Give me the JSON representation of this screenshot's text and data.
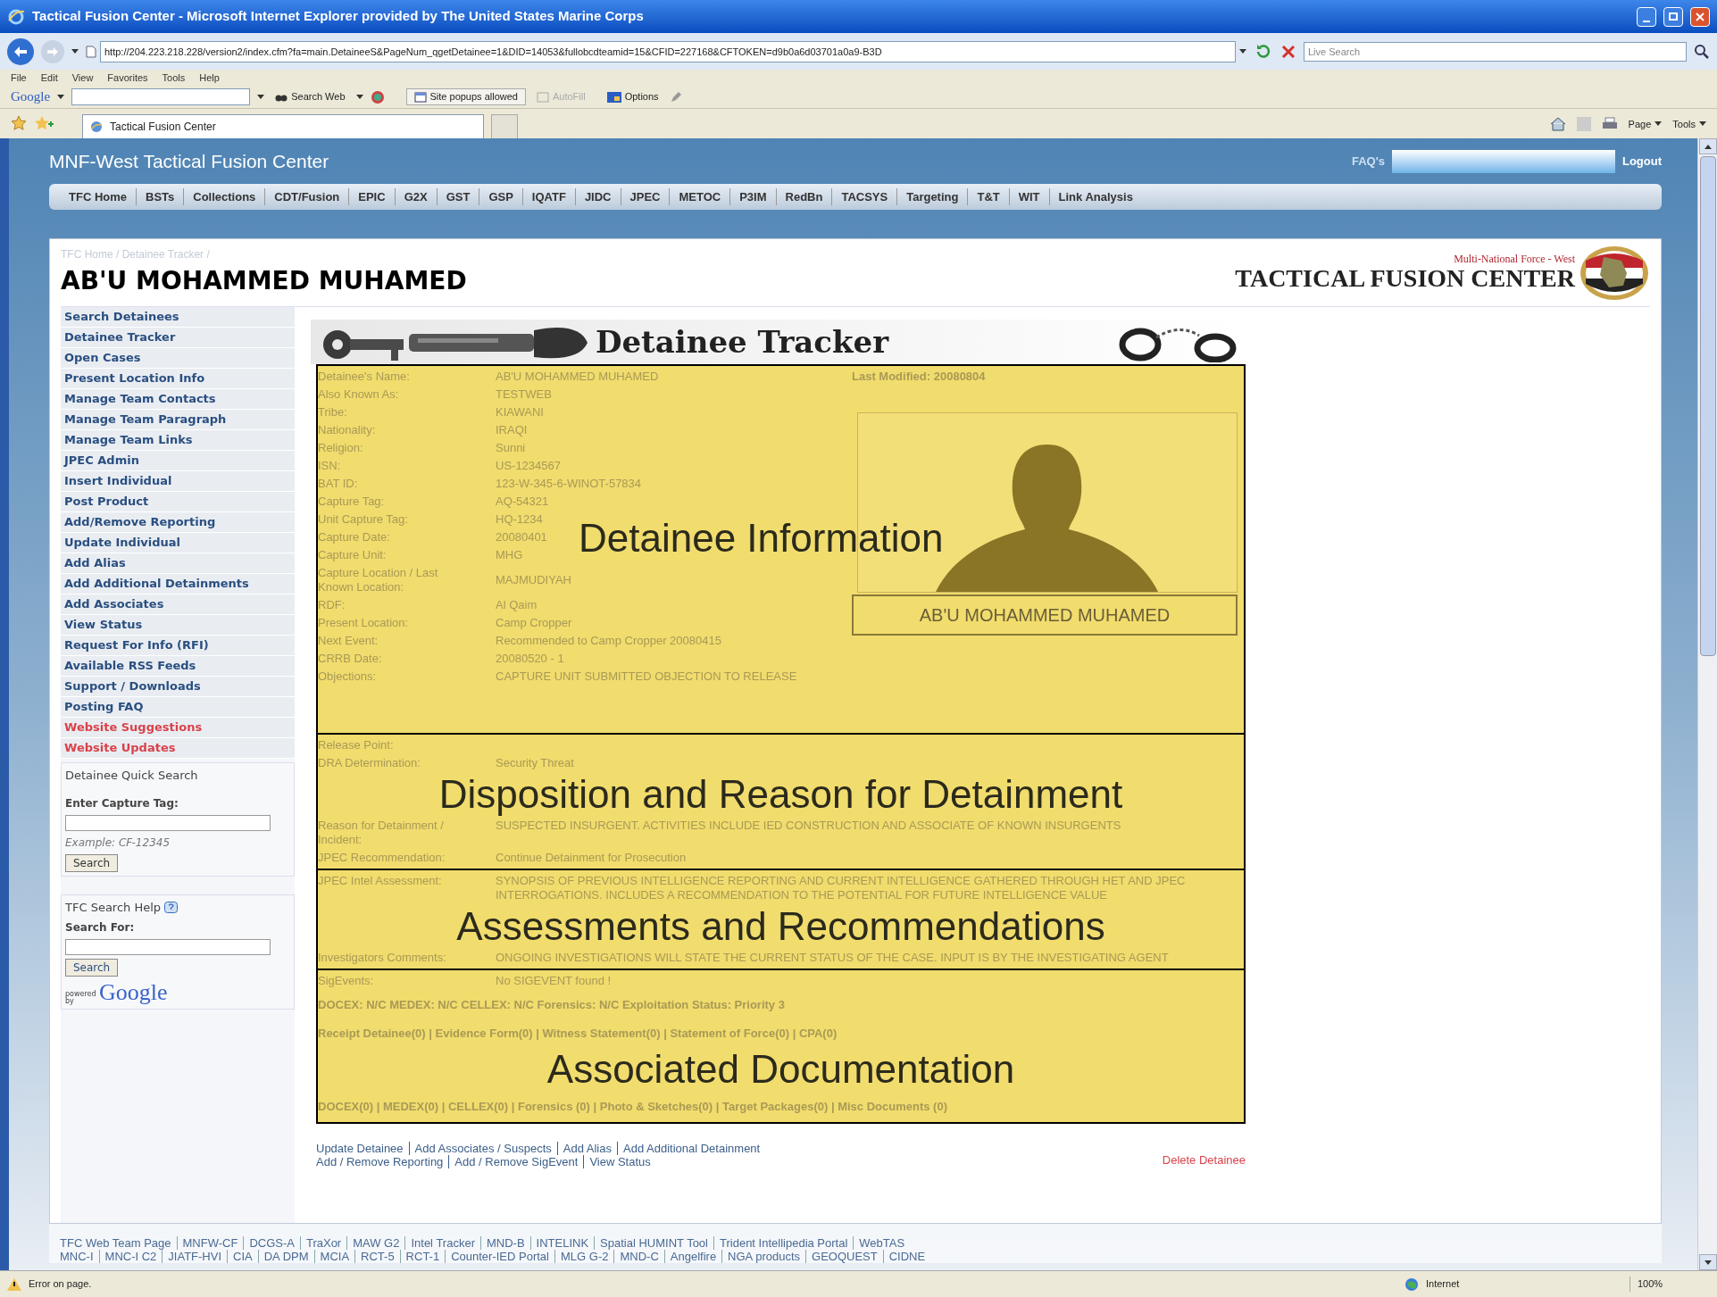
{
  "window": {
    "title": "Tactical Fusion Center - Microsoft Internet Explorer provided by The United States Marine Corps"
  },
  "address_bar": {
    "url": "http://204.223.218.228/version2/index.cfm?fa=main.DetaineeS&PageNum_qgetDetainee=1&DID=14053&fullobcdteamid=15&CFID=227168&CFTOKEN=d9b0a6d03701a0a9-B3D",
    "search_placeholder": "Live Search"
  },
  "menu": [
    "File",
    "Edit",
    "View",
    "Favorites",
    "Tools",
    "Help"
  ],
  "google_toolbar": {
    "logo": "Google",
    "search_button": "Search Web",
    "popups": "Site popups allowed",
    "autofill": "AutoFill",
    "options": "Options"
  },
  "tabs": [
    {
      "label": "Tactical Fusion Center",
      "selected": true
    }
  ],
  "command_bar": [
    "Page",
    "Tools"
  ],
  "site": {
    "title": "MNF-West Tactical Fusion Center",
    "faq": "FAQ's",
    "logout": "Logout"
  },
  "nav": [
    "TFC Home",
    "BSTs",
    "Collections",
    "CDT/Fusion",
    "EPIC",
    "G2X",
    "GST",
    "GSP",
    "IQATF",
    "JIDC",
    "JPEC",
    "METOC",
    "P3IM",
    "RedBn",
    "TACSYS",
    "Targeting",
    "T&T",
    "WIT",
    "Link Analysis"
  ],
  "breadcrumb": "TFC Home / Detainee Tracker /",
  "page_title": "AB'U MOHAMMED MUHAMED",
  "logo": {
    "subtitle": "Multi-National Force - West",
    "title": "TACTICAL FUSION CENTER"
  },
  "sidebar": {
    "items": [
      {
        "label": "Search Detainees",
        "color": "#2a4f80"
      },
      {
        "label": "Detainee Tracker",
        "color": "#2a4f80"
      },
      {
        "label": "Open Cases",
        "color": "#2a4f80"
      },
      {
        "label": "Present Location Info",
        "color": "#2a4f80"
      },
      {
        "label": "Manage Team Contacts",
        "color": "#2a4f80"
      },
      {
        "label": "Manage Team Paragraph",
        "color": "#2a4f80"
      },
      {
        "label": "Manage Team Links",
        "color": "#2a4f80"
      },
      {
        "label": "JPEC Admin",
        "color": "#2a4f80"
      },
      {
        "label": "Insert Individual",
        "color": "#2a4f80"
      },
      {
        "label": "Post Product",
        "color": "#2a4f80"
      },
      {
        "label": "Add/Remove Reporting",
        "color": "#2a4f80"
      },
      {
        "label": "Update Individual",
        "color": "#2a4f80"
      },
      {
        "label": "Add Alias",
        "color": "#2a4f80"
      },
      {
        "label": "Add Additional Detainments",
        "color": "#2a4f80"
      },
      {
        "label": "Add Associates",
        "color": "#2a4f80"
      },
      {
        "label": "View Status",
        "color": "#2a4f80"
      },
      {
        "label": "Request For Info (RFI)",
        "color": "#2a4f80"
      },
      {
        "label": "Available RSS Feeds",
        "color": "#2a4f80"
      },
      {
        "label": "Support / Downloads",
        "color": "#2a4f80"
      },
      {
        "label": "Posting FAQ",
        "color": "#2a4f80"
      },
      {
        "label": "Website Suggestions",
        "color": "#d9424a"
      },
      {
        "label": "Website Updates",
        "color": "#d9424a"
      }
    ],
    "quick_search": {
      "title": "Detainee Quick Search",
      "label": "Enter Capture Tag:",
      "example": "Example: CF-12345",
      "button": "Search"
    },
    "google_search": {
      "title": "TFC Search Help",
      "label": "Search For:",
      "button": "Search",
      "powered": "powered by",
      "brand": "Google"
    }
  },
  "tracker": {
    "banner_title": "Detainee Tracker",
    "last_modified": "Last Modified: 20080804",
    "photo_caption": "AB'U MOHAMMED MUHAMED",
    "sections": [
      {
        "kind": "profile",
        "overlay_label": "Detainee Information",
        "rows": [
          {
            "kind": "field",
            "label": "Detainee's Name:",
            "value": "AB'U MOHAMMED MUHAMED"
          },
          {
            "kind": "field",
            "label": "Also Known As:",
            "value": "TESTWEB"
          },
          {
            "kind": "field",
            "label": "Tribe:",
            "value": "KIAWANI"
          },
          {
            "kind": "field",
            "label": "Nationality:",
            "value": "IRAQI"
          },
          {
            "kind": "field",
            "label": "Religion:",
            "value": "Sunni"
          },
          {
            "kind": "field",
            "label": "ISN:",
            "value": "US-1234567"
          },
          {
            "kind": "field",
            "label": "BAT ID:",
            "value": "123-W-345-6-WINOT-57834"
          },
          {
            "kind": "field",
            "label": "Capture Tag:",
            "value": "AQ-54321"
          },
          {
            "kind": "field",
            "label": "Unit Capture Tag:",
            "value": "HQ-1234"
          },
          {
            "kind": "field",
            "label": "Capture Date:",
            "value": "20080401"
          },
          {
            "kind": "field",
            "label": "Capture Unit:",
            "value": "MHG"
          },
          {
            "kind": "field",
            "label": "Capture Location / Last Known Location:",
            "value": "MAJMUDIYAH"
          },
          {
            "kind": "field",
            "label": "RDF:",
            "value": "Al Qaim"
          },
          {
            "kind": "field",
            "label": "Present Location:",
            "value": "Camp Cropper"
          },
          {
            "kind": "field",
            "label": "Next Event:",
            "value": "Recommended to Camp Cropper 20080415"
          },
          {
            "kind": "field",
            "label": "CRRB Date:",
            "value": "20080520 - 1"
          },
          {
            "kind": "field",
            "label": "Objections:",
            "value": "CAPTURE UNIT SUBMITTED OBJECTION TO RELEASE"
          }
        ]
      },
      {
        "kind": "plain",
        "rows": [
          {
            "kind": "field",
            "label": "Release Point:"
          },
          {
            "kind": "field",
            "label": "DRA Determination:",
            "value": "Security Threat"
          },
          {
            "kind": "overlay",
            "text": "Disposition and Reason for Detainment"
          },
          {
            "kind": "field",
            "label": "Reason for Detainment / Incident:",
            "value": "SUSPECTED INSURGENT. ACTIVITIES INCLUDE IED CONSTRUCTION AND ASSOCIATE OF KNOWN INSURGENTS"
          },
          {
            "kind": "field",
            "label": "JPEC Recommendation:",
            "value": "Continue Detainment for Prosecution"
          }
        ]
      },
      {
        "kind": "plain",
        "rows": [
          {
            "kind": "field",
            "label": "JPEC Intel Assessment:",
            "value": "SYNOPSIS OF PREVIOUS INTELLIGENCE REPORTING AND CURRENT INTELLIGENCE GATHERED THROUGH HET AND JPEC INTERROGATIONS. INCLUDES A RECOMMENDATION TO THE POTENTIAL FOR FUTURE INTELLIGENCE VALUE"
          },
          {
            "kind": "overlay",
            "text": "Assessments and Recommendations"
          },
          {
            "kind": "field",
            "label": "Investigators Comments:",
            "value": "ONGOING INVESTIGATIONS WILL STATE THE CURRENT STATUS OF THE CASE. INPUT IS BY THE INVESTIGATING AGENT"
          }
        ]
      },
      {
        "kind": "plain",
        "rows": [
          {
            "kind": "field",
            "label": "SigEvents:",
            "value": "No SIGEVENT found !"
          },
          {
            "kind": "line",
            "text": "DOCEX: N/C MEDEX: N/C CELLEX: N/C Forensics: N/C Exploitation Status: Priority 3"
          },
          {
            "kind": "line",
            "text": "Receipt Detainee(0) | Evidence Form(0) | Witness Statement(0) | Statement of Force(0) | CPA(0)"
          },
          {
            "kind": "overlay",
            "text": "Associated Documentation"
          },
          {
            "kind": "line",
            "text": "DOCEX(0) | MEDEX(0) | CELLEX(0) | Forensics (0) | Photo & Sketches(0) | Target Packages(0) | Misc Documents (0)"
          }
        ]
      }
    ]
  },
  "actions": {
    "lines": [
      [
        "Update Detainee",
        "Add Associates / Suspects",
        "Add Alias",
        "Add Additional Detainment"
      ],
      [
        "Add / Remove Reporting",
        "Add / Remove SigEvent",
        "View Status"
      ]
    ],
    "delete": "Delete Detainee"
  },
  "footer_links": [
    [
      "TFC Web Team Page",
      "MNFW-CF",
      "DCGS-A",
      "TraXor",
      "MAW G2",
      "Intel Tracker",
      "MND-B",
      "INTELINK",
      "Spatial HUMINT Tool",
      "Trident Intellipedia Portal",
      "WebTAS"
    ],
    [
      "MNC-I",
      "MNC-I C2",
      "JIATF-HVI",
      "CIA",
      "DA DPM",
      "MCIA",
      "RCT-5",
      "RCT-1",
      "Counter-IED Portal",
      "MLG G-2",
      "MND-C",
      "Angelfire",
      "NGA products",
      "GEOQUEST",
      "CIDNE"
    ]
  ],
  "status_bar": {
    "message": "Error on page.",
    "zone": "Internet",
    "zoom": "100%"
  }
}
